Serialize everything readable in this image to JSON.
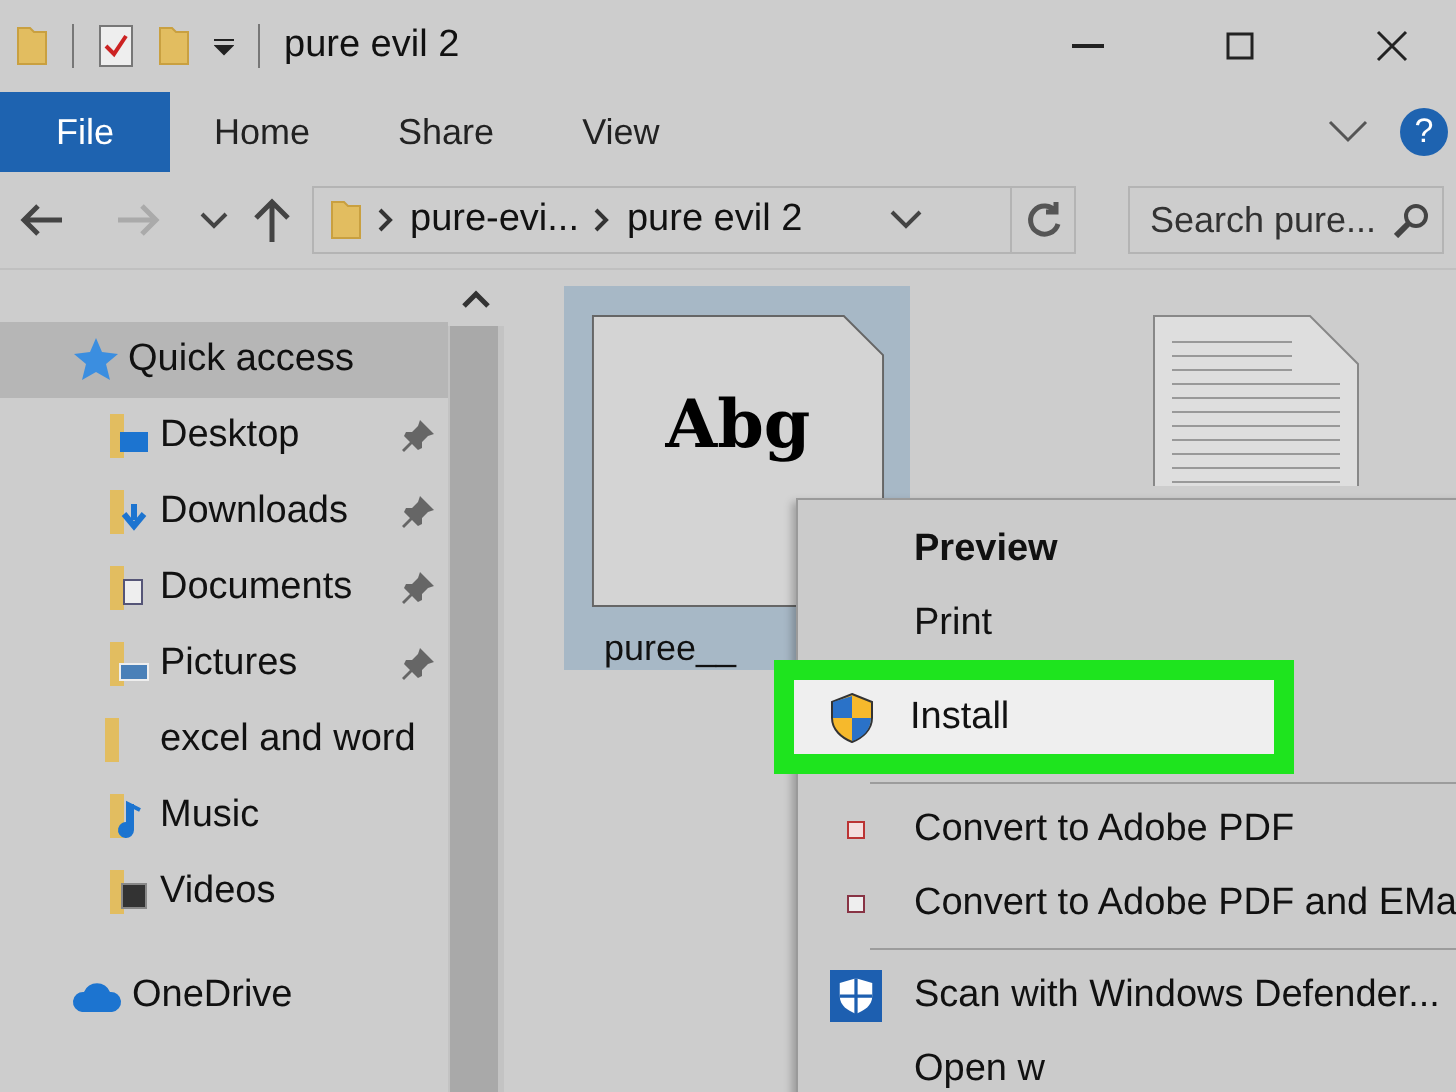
{
  "window": {
    "title": "pure evil 2"
  },
  "ribbon": {
    "tabs": [
      {
        "label": "File",
        "selected": true
      },
      {
        "label": "Home",
        "selected": false
      },
      {
        "label": "Share",
        "selected": false
      },
      {
        "label": "View",
        "selected": false
      }
    ],
    "help": "?"
  },
  "address": {
    "crumbs": [
      "pure-evi...",
      "pure evil 2"
    ],
    "search": {
      "placeholder": "Search pure..."
    }
  },
  "sidebar": {
    "items": [
      {
        "label": "Quick access",
        "kind": "star",
        "selected": true,
        "children": [
          {
            "label": "Desktop",
            "kind": "desktop",
            "pinned": true
          },
          {
            "label": "Downloads",
            "kind": "downloads",
            "pinned": true
          },
          {
            "label": "Documents",
            "kind": "documents",
            "pinned": true
          },
          {
            "label": "Pictures",
            "kind": "pictures",
            "pinned": true
          },
          {
            "label": "excel and word",
            "kind": "folder",
            "pinned": false
          },
          {
            "label": "Music",
            "kind": "music",
            "pinned": false
          },
          {
            "label": "Videos",
            "kind": "videos",
            "pinned": false
          }
        ]
      },
      {
        "label": "OneDrive",
        "kind": "cloud",
        "selected": false
      }
    ]
  },
  "files": [
    {
      "name": "puree__",
      "kind": "font",
      "preview": "Abg",
      "selected": true
    },
    {
      "kind": "text",
      "selected": false
    }
  ],
  "context_menu": {
    "groups": [
      [
        {
          "label": "Preview",
          "kind": "none",
          "default": true,
          "selected": false
        },
        {
          "label": "Print",
          "kind": "none",
          "default": false,
          "selected": false
        },
        {
          "label": "Install",
          "kind": "shield",
          "default": false,
          "selected": true
        }
      ],
      [
        {
          "label": "Convert to Adobe PDF",
          "kind": "pdf",
          "default": false,
          "selected": false
        },
        {
          "label": "Convert to Adobe PDF and EMa",
          "kind": "pdf-mail",
          "default": false,
          "selected": false
        }
      ],
      [
        {
          "label": "Scan with Windows Defender...",
          "kind": "defender",
          "default": false,
          "selected": false
        },
        {
          "label": "Open w",
          "kind": "none",
          "default": false,
          "selected": false
        }
      ]
    ]
  }
}
